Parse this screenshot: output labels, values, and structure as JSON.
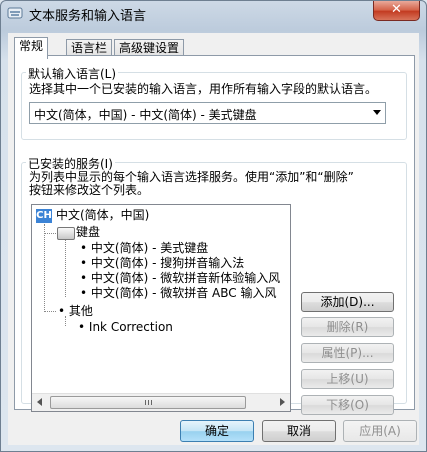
{
  "window": {
    "title": "文本服务和输入语言",
    "close_glyph": "✕"
  },
  "tabs": [
    {
      "label": "常规",
      "active": true
    },
    {
      "label": "语言栏",
      "active": false
    },
    {
      "label": "高级键设置",
      "active": false
    }
  ],
  "default_language": {
    "group_label": "默认输入语言(L)",
    "description": "选择其中一个已安装的输入语言，用作所有输入字段的默认语言。",
    "selected": "中文(简体，中国) - 中文(简体) - 美式键盘"
  },
  "installed_services": {
    "group_label": "已安装的服务(I)",
    "description_line1": "为列表中显示的每个输入语言选择服务。使用“添加”和“删除”",
    "description_line2": "按钮来修改这个列表。",
    "tree": {
      "language_icon": "CH",
      "language": "中文(简体，中国)",
      "keyboard_group": "键盘",
      "keyboards": [
        "中文(简体) - 美式键盘",
        "中文(简体) - 搜狗拼音输入法",
        "中文(简体) - 微软拼音新体验输入风",
        "中文(简体) - 微软拼音 ABC 输入风"
      ],
      "other_group": "其他",
      "others": [
        "Ink Correction"
      ]
    },
    "buttons": {
      "add": "添加(D)...",
      "remove": "删除(R)",
      "properties": "属性(P)...",
      "move_up": "上移(U)",
      "move_down": "下移(O)"
    }
  },
  "footer": {
    "ok": "确定",
    "cancel": "取消",
    "apply": "应用(A)"
  }
}
